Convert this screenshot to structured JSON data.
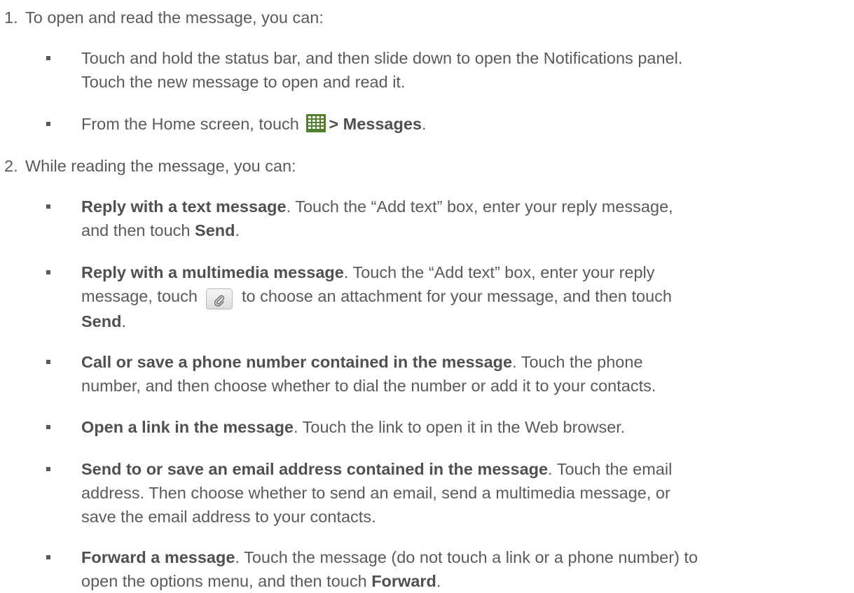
{
  "steps": [
    {
      "number": "1.",
      "text": "To open and read the message, you can:"
    },
    {
      "number": "2.",
      "text": "While reading the message, you can:"
    }
  ],
  "step1_bullets": {
    "b1": {
      "line1": "Touch and hold the status bar, and then slide down to open the Notifications panel.",
      "line2": "Touch the new message to open and read it."
    },
    "b2": {
      "pre": "From the Home screen, touch ",
      "bold": "> Messages",
      "post": "."
    }
  },
  "step2_bullets": {
    "reply_text": {
      "bold": "Reply with a text message",
      "rest1": ". Touch the “Add text” box, enter your reply message,",
      "line2_pre": "and then touch ",
      "line2_bold": "Send",
      "line2_post": "."
    },
    "reply_mms": {
      "bold": "Reply with a multimedia message",
      "rest1": ". Touch the “Add text” box, enter your reply",
      "line2_pre": "message, touch ",
      "line2_post": " to choose an attachment for your message, and then touch",
      "line3_bold": "Send",
      "line3_post": "."
    },
    "call_save": {
      "bold": "Call or save a phone number contained in the message",
      "rest1": ". Touch the phone",
      "line2": "number, and then choose whether to dial the number or add it to your contacts."
    },
    "open_link": {
      "bold": "Open a link in the message",
      "rest1": ". Touch the link to open it in the Web browser."
    },
    "email": {
      "bold": "Send to or save an email address contained in the message",
      "rest1": ". Touch the email",
      "line2": "address. Then choose whether to send an email, send a multimedia message, or",
      "line3": "save the email address to your contacts."
    },
    "forward": {
      "bold": "Forward a message",
      "rest1": ". Touch the message (do not touch a link or a phone number) to",
      "line2_pre": "open the options menu, and then touch ",
      "line2_bold": "Forward",
      "line2_post": "."
    }
  },
  "icons": {
    "apps": "apps-grid-icon",
    "attach": "paperclip-icon"
  },
  "colors": {
    "text": "#5a5a5a",
    "icon_green": "#4f7f2a"
  }
}
